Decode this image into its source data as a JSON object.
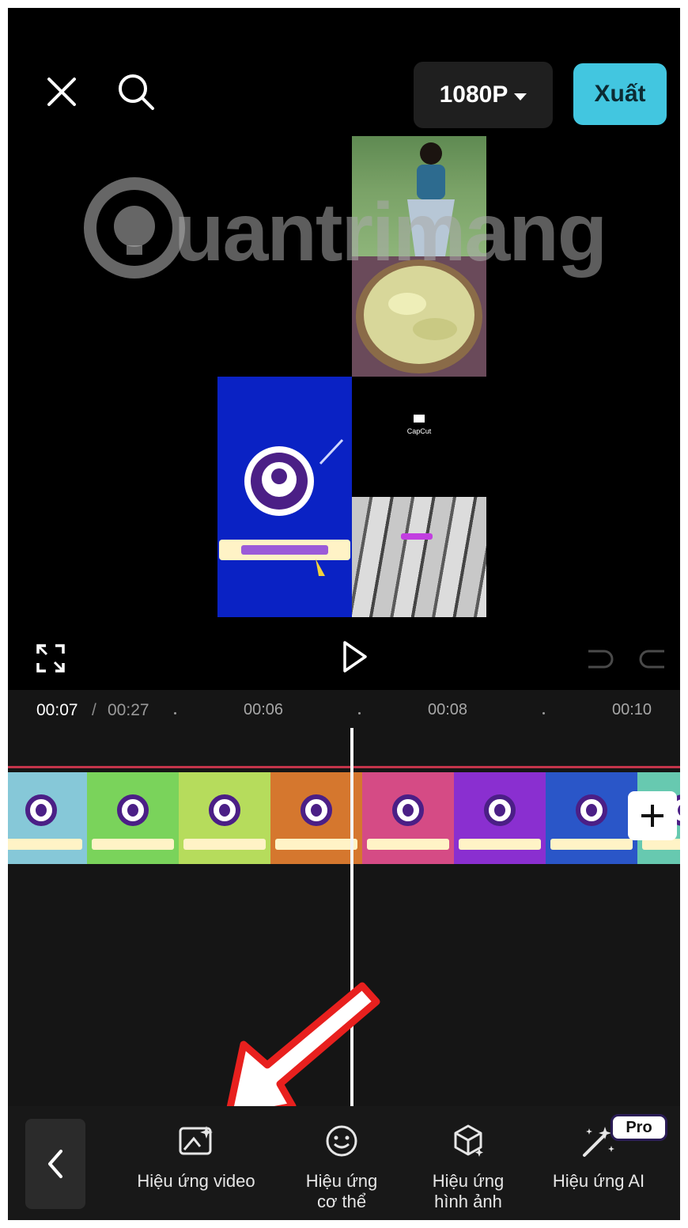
{
  "header": {
    "close_icon": "close-icon",
    "search_icon": "search-icon",
    "resolution_label": "1080P",
    "export_label": "Xuất",
    "accent_color": "#42c6e0"
  },
  "preview": {
    "watermark_text": "uantrimang",
    "capcut_label": "CapCut"
  },
  "controls": {
    "fullscreen_icon": "fullscreen-icon",
    "play_icon": "play-icon",
    "undo_icon": "undo-icon",
    "redo_icon": "redo-icon"
  },
  "timeline": {
    "current_time": "00:07",
    "separator": "/",
    "total_time": "00:27",
    "ticks": [
      "00:06",
      "00:08",
      "00:10"
    ],
    "clip_colors": [
      "#86c8d8",
      "#7ad35b",
      "#b6dc5c",
      "#d5772e",
      "#d54b85",
      "#8a2fd0",
      "#2a56c8",
      "#67c9b0"
    ],
    "add_icon": "plus-icon"
  },
  "toolbar": {
    "back_icon": "chevron-left-icon",
    "tools": [
      {
        "label": "Hiệu ứng video",
        "icon": "video-effect-icon"
      },
      {
        "label": "Hiệu ứng\ncơ thể",
        "icon": "body-effect-icon"
      },
      {
        "label": "Hiệu ứng\nhình ảnh",
        "icon": "image-effect-icon"
      },
      {
        "label": "Hiệu ứng AI",
        "icon": "ai-effect-icon"
      }
    ],
    "pro_badge": "Pro"
  },
  "annotation": {
    "arrow_color": "#e8201e"
  }
}
